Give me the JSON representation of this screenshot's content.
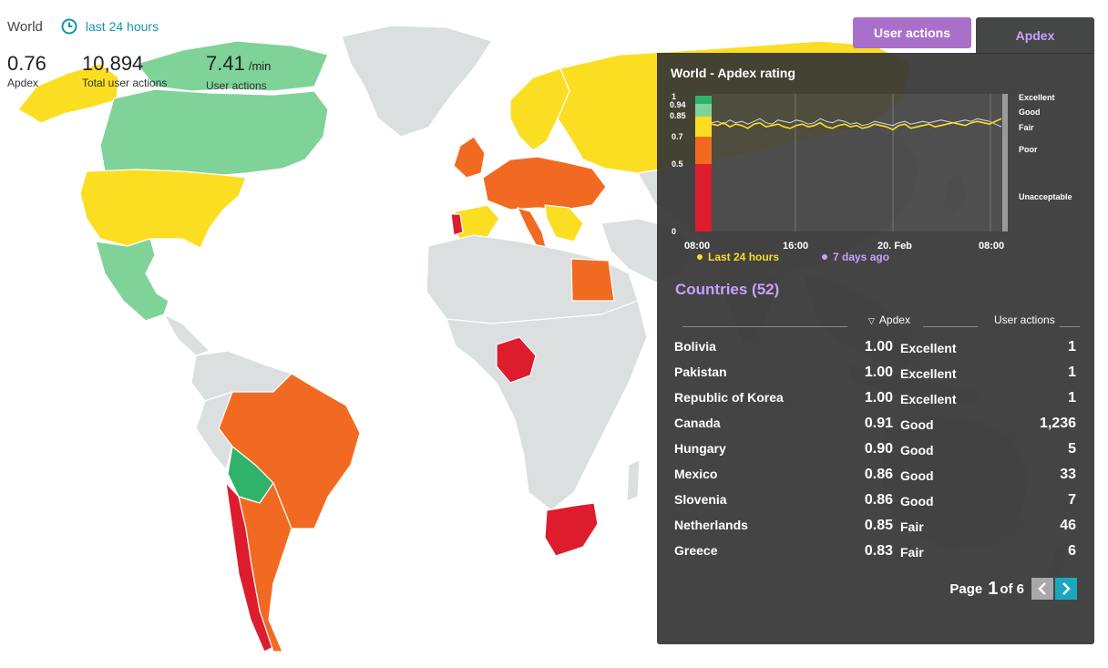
{
  "header": {
    "scope": "World",
    "timeframe": "last 24 hours"
  },
  "kpis": [
    {
      "value": "0.76",
      "unit": "",
      "label": "Apdex"
    },
    {
      "value": "10,894",
      "unit": "",
      "label": "Total user actions"
    },
    {
      "value": "7.41",
      "unit": "/min",
      "label": "User actions"
    }
  ],
  "tabs": {
    "user_actions": "User actions",
    "apdex": "Apdex"
  },
  "chart": {
    "title": "World - Apdex rating",
    "y_ticks": [
      "1",
      "0.94",
      "0.85",
      "0.7",
      "0.5",
      "0"
    ],
    "zone_labels": [
      "Excellent",
      "Good",
      "Fair",
      "Poor",
      "Unacceptable"
    ],
    "x_ticks": [
      "08:00",
      "16:00",
      "20. Feb",
      "08:00"
    ],
    "legend": {
      "last": "Last 24 hours",
      "prev": "7 days ago"
    },
    "colors": {
      "excellent": "#2fb36b",
      "good": "#7fd399",
      "fair": "#fbde22",
      "poor": "#f26a21",
      "unacceptable": "#dd1d2d",
      "last": "#fbde22",
      "prev": "#c8a0ff"
    }
  },
  "chart_data": {
    "type": "line",
    "title": "World - Apdex rating",
    "xlabel": "",
    "ylabel": "",
    "ylim": [
      0,
      1
    ],
    "x_ticks": [
      "08:00",
      "16:00",
      "20. Feb",
      "08:00"
    ],
    "series": [
      {
        "name": "Last 24 hours",
        "values": [
          0.78,
          0.77,
          0.79,
          0.76,
          0.78,
          0.77,
          0.75,
          0.78,
          0.79,
          0.76,
          0.77,
          0.78,
          0.76,
          0.75,
          0.77,
          0.78,
          0.76,
          0.77,
          0.79,
          0.76,
          0.75,
          0.77,
          0.78,
          0.76,
          0.77,
          0.75,
          0.76,
          0.78,
          0.77,
          0.76,
          0.74,
          0.77,
          0.78,
          0.75,
          0.76,
          0.77,
          0.78,
          0.76,
          0.77,
          0.78,
          0.79,
          0.78,
          0.77,
          0.79,
          0.8,
          0.79,
          0.78,
          0.8,
          0.82
        ]
      },
      {
        "name": "7 days ago",
        "values": [
          0.79,
          0.8,
          0.78,
          0.81,
          0.79,
          0.8,
          0.78,
          0.8,
          0.82,
          0.79,
          0.78,
          0.81,
          0.8,
          0.79,
          0.81,
          0.8,
          0.78,
          0.79,
          0.82,
          0.8,
          0.79,
          0.81,
          0.8,
          0.78,
          0.79,
          0.77,
          0.78,
          0.8,
          0.79,
          0.78,
          0.77,
          0.79,
          0.8,
          0.78,
          0.79,
          0.8,
          0.79,
          0.8,
          0.81,
          0.8,
          0.79,
          0.8,
          0.81,
          0.8,
          0.82,
          0.81,
          0.8,
          0.78,
          0.76
        ]
      }
    ]
  },
  "countries": {
    "title": "Countries (52)",
    "columns": {
      "apdex": "Apdex",
      "user_actions": "User actions"
    },
    "rows": [
      {
        "name": "Bolivia",
        "score": "1.00",
        "rating": "Excellent",
        "actions": "1"
      },
      {
        "name": "Pakistan",
        "score": "1.00",
        "rating": "Excellent",
        "actions": "1"
      },
      {
        "name": "Republic of Korea",
        "score": "1.00",
        "rating": "Excellent",
        "actions": "1"
      },
      {
        "name": "Canada",
        "score": "0.91",
        "rating": "Good",
        "actions": "1,236"
      },
      {
        "name": "Hungary",
        "score": "0.90",
        "rating": "Good",
        "actions": "5"
      },
      {
        "name": "Mexico",
        "score": "0.86",
        "rating": "Good",
        "actions": "33"
      },
      {
        "name": "Slovenia",
        "score": "0.86",
        "rating": "Good",
        "actions": "7"
      },
      {
        "name": "Netherlands",
        "score": "0.85",
        "rating": "Fair",
        "actions": "46"
      },
      {
        "name": "Greece",
        "score": "0.83",
        "rating": "Fair",
        "actions": "6"
      }
    ]
  },
  "pagination": {
    "page_label": "Page",
    "current": "1",
    "of_label": "of 6"
  },
  "map_colors": {
    "no_data": "#dcdfdf",
    "excellent": "#2fb36b",
    "good": "#7fd399",
    "fair": "#fbde22",
    "poor": "#f26a21",
    "unacceptable": "#dd1d2d"
  }
}
